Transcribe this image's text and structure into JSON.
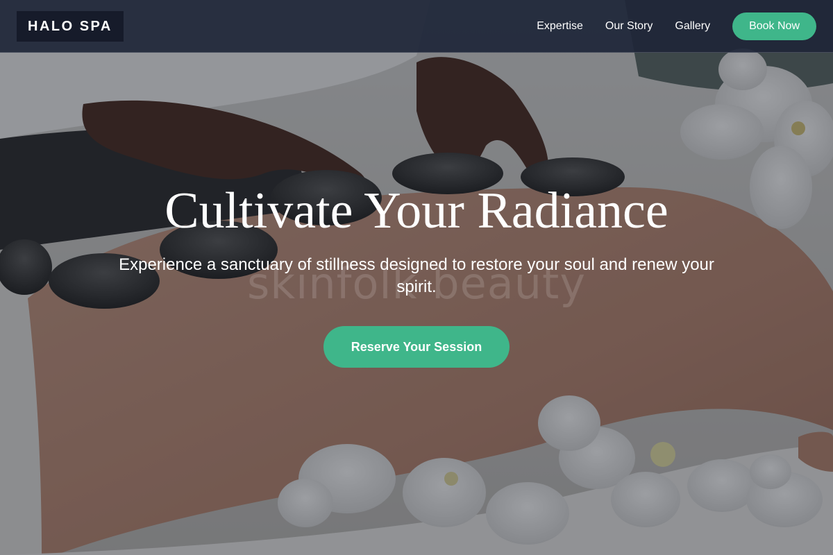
{
  "brand": {
    "logo_text": "HALO SPA"
  },
  "nav": {
    "links": [
      "Expertise",
      "Our Story",
      "Gallery"
    ],
    "cta_label": "Book Now"
  },
  "hero": {
    "title": "Cultivate Your Radiance",
    "subtitle": "Experience a sanctuary of stillness designed to restore your soul and renew your spirit.",
    "cta_label": "Reserve Your Session",
    "watermark_text": "skinfolk beauty",
    "background_image": "hot-stone-massage-photo"
  },
  "colors": {
    "accent": "#3fb68a",
    "nav_background": "#1e2638",
    "text": "#ffffff"
  }
}
